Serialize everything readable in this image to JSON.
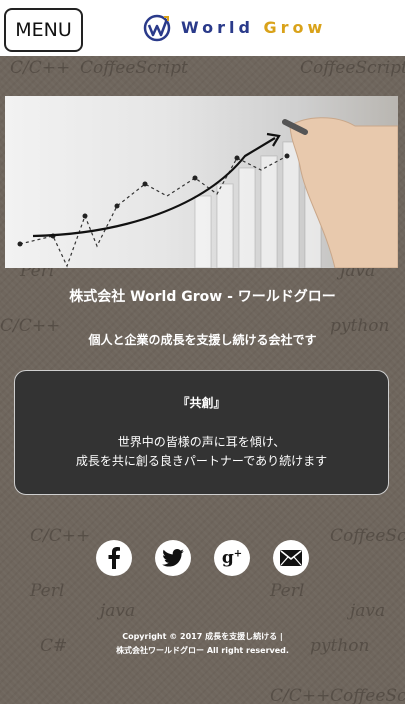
{
  "header": {
    "menu_label": "MENU",
    "logo_word1": "World",
    "logo_word2": "Grow"
  },
  "hero": {
    "image_name": "business-growth-chart-photo"
  },
  "main": {
    "company_name": "株式会社 World Grow - ワールドグロー",
    "tagline": "個人と企業の成長を支援し続ける会社です",
    "card": {
      "title": "『共創』",
      "line1": "世界中の皆様の声に耳を傾け、",
      "line2": "成長を共に創る良きパートナーであり続けます"
    }
  },
  "social": [
    {
      "name": "facebook-icon",
      "glyph": "f"
    },
    {
      "name": "twitter-icon",
      "glyph": ""
    },
    {
      "name": "google-plus-icon",
      "glyph": "g+"
    },
    {
      "name": "mail-icon",
      "glyph": ""
    }
  ],
  "footer": {
    "line1": "Copyright © 2017 成長を支援し続ける |",
    "line2": "株式会社ワールドグロー All right reserved."
  },
  "background_watermarks": [
    "C/C++",
    "CoffeeScript",
    "Perl",
    "java",
    "python",
    "C#"
  ],
  "colors": {
    "logo_blue": "#2a3a8a",
    "logo_gold": "#d9a21a",
    "card_bg": "#333333",
    "page_bg": "#6f665d"
  }
}
